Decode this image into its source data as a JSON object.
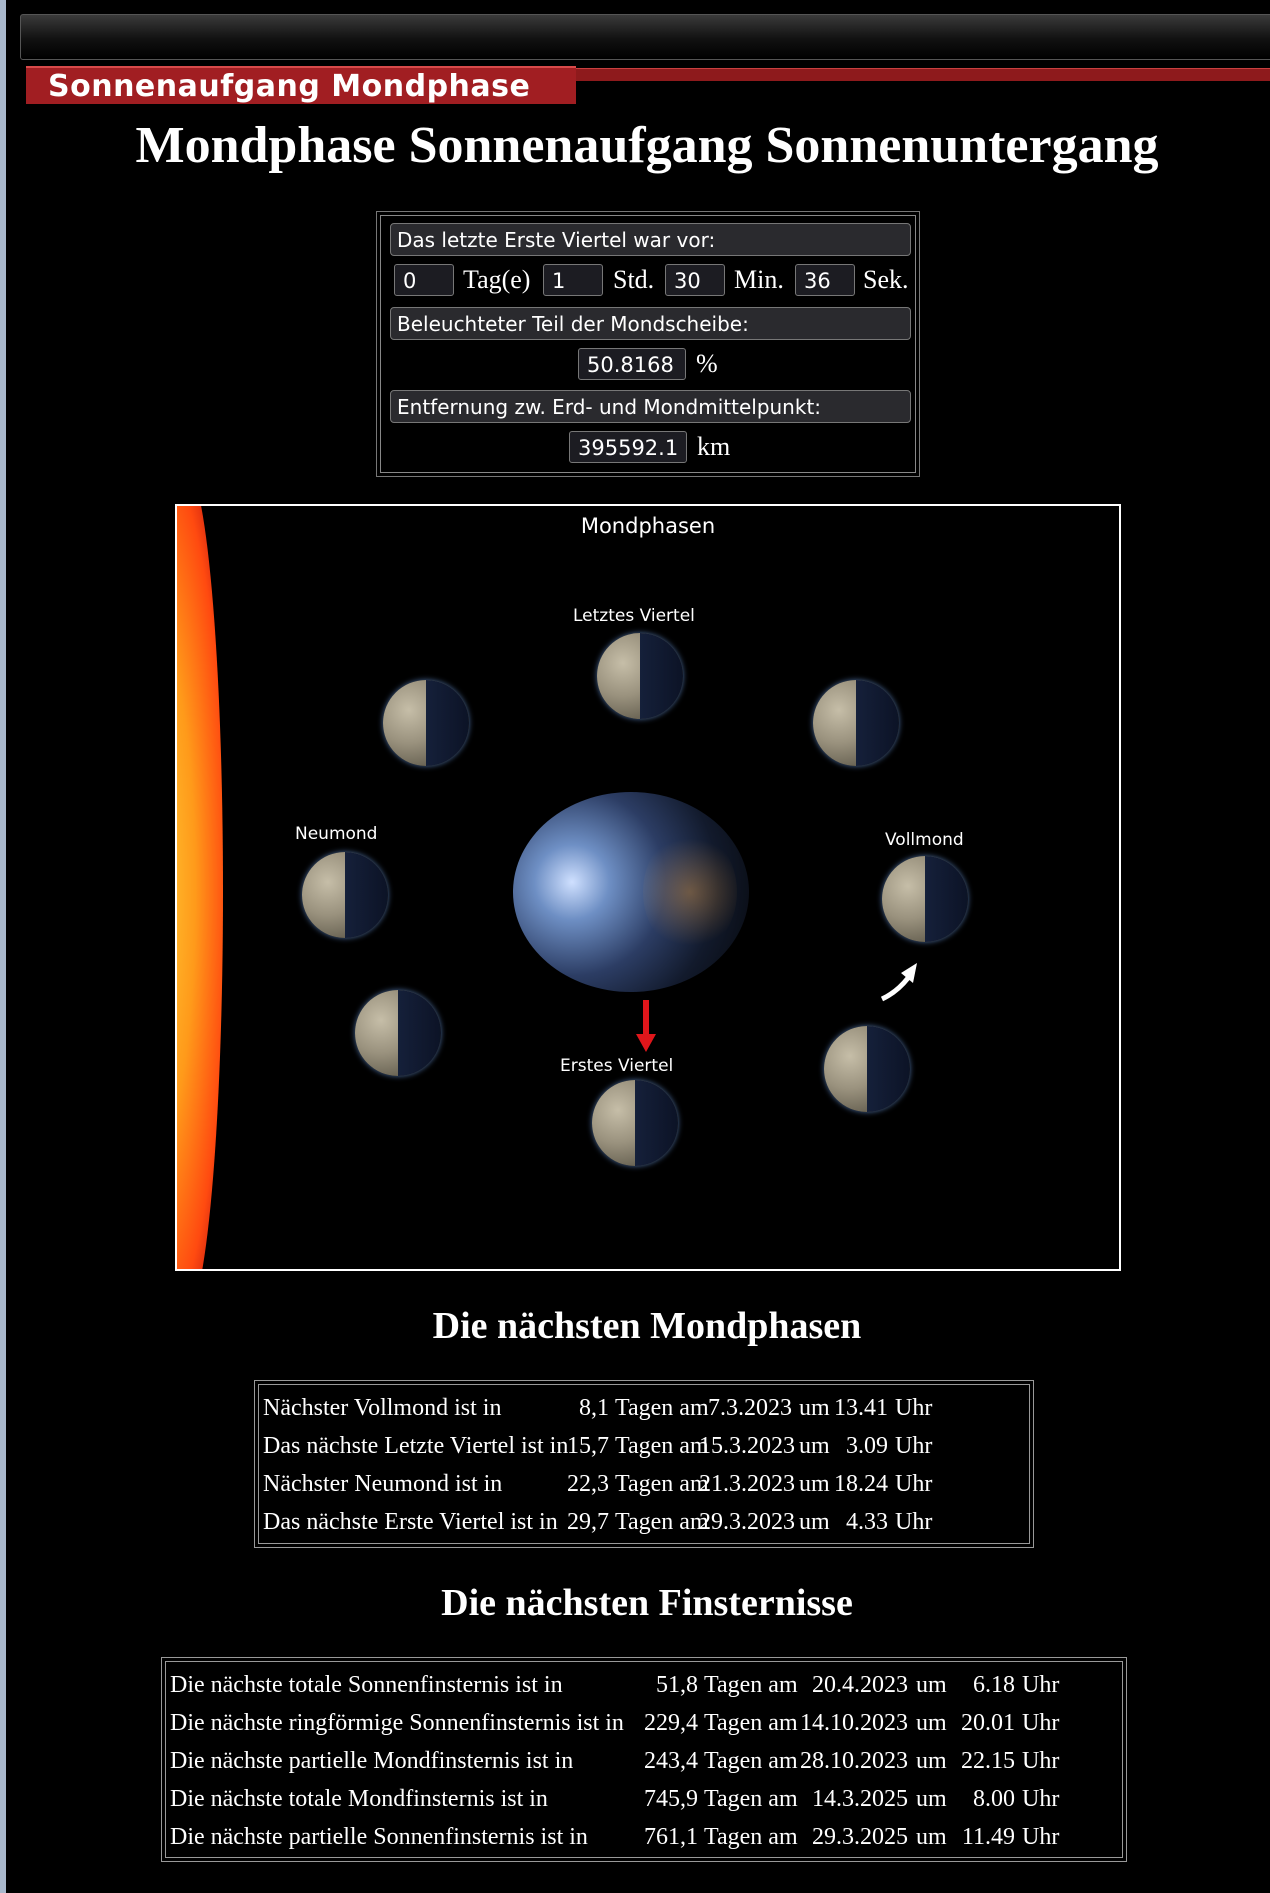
{
  "header": {
    "tab_label": "Sonnenaufgang Mondphase"
  },
  "page_title": "Mondphase Sonnenaufgang Sonnenuntergang",
  "last_phase": {
    "label": "Das letzte Erste Viertel war vor:",
    "days": "0",
    "days_unit": "Tag(e)",
    "hours": "1",
    "hours_unit": "Std.",
    "minutes": "30",
    "minutes_unit": "Min.",
    "seconds": "36",
    "seconds_unit": "Sek."
  },
  "illumination": {
    "label": "Beleuchteter Teil der Mondscheibe:",
    "value": "50.8168",
    "unit": "%"
  },
  "distance": {
    "label": "Entfernung zw. Erd- und Mondmittelpunkt:",
    "value": "395592.1",
    "unit": "km"
  },
  "diagram": {
    "title": "Mondphasen",
    "labels": {
      "last_quarter": "Letztes Viertel",
      "new_moon": "Neumond",
      "full_moon": "Vollmond",
      "first_quarter": "Erstes Viertel"
    }
  },
  "next_phases": {
    "heading": "Die nächsten Mondphasen",
    "rows": [
      {
        "label": "Nächster Vollmond ist in",
        "days": "8,1",
        "date": "7.3.2023",
        "time": "13.41"
      },
      {
        "label": "Das nächste Letzte Viertel ist in",
        "days": "15,7",
        "date": "15.3.2023",
        "time": "3.09"
      },
      {
        "label": "Nächster Neumond ist in",
        "days": "22,3",
        "date": "21.3.2023",
        "time": "18.24"
      },
      {
        "label": "Das nächste Erste Viertel ist in",
        "days": "29,7",
        "date": "29.3.2023",
        "time": "4.33"
      }
    ]
  },
  "next_eclipses": {
    "heading": "Die nächsten Finsternisse",
    "rows": [
      {
        "label": "Die nächste totale Sonnenfinsternis ist in",
        "days": "51,8",
        "date": "20.4.2023",
        "time": "6.18"
      },
      {
        "label": "Die nächste ringförmige Sonnenfinsternis ist in",
        "days": "229,4",
        "date": "14.10.2023",
        "time": "20.01"
      },
      {
        "label": "Die nächste partielle Mondfinsternis ist in",
        "days": "243,4",
        "date": "28.10.2023",
        "time": "22.15"
      },
      {
        "label": "Die nächste totale Mondfinsternis ist in",
        "days": "745,9",
        "date": "14.3.2025",
        "time": "8.00"
      },
      {
        "label": "Die nächste partielle Sonnenfinsternis ist in",
        "days": "761,1",
        "date": "29.3.2025",
        "time": "11.49"
      }
    ]
  },
  "words": {
    "tagen_am": "Tagen am",
    "um": "um",
    "uhr": "Uhr"
  }
}
